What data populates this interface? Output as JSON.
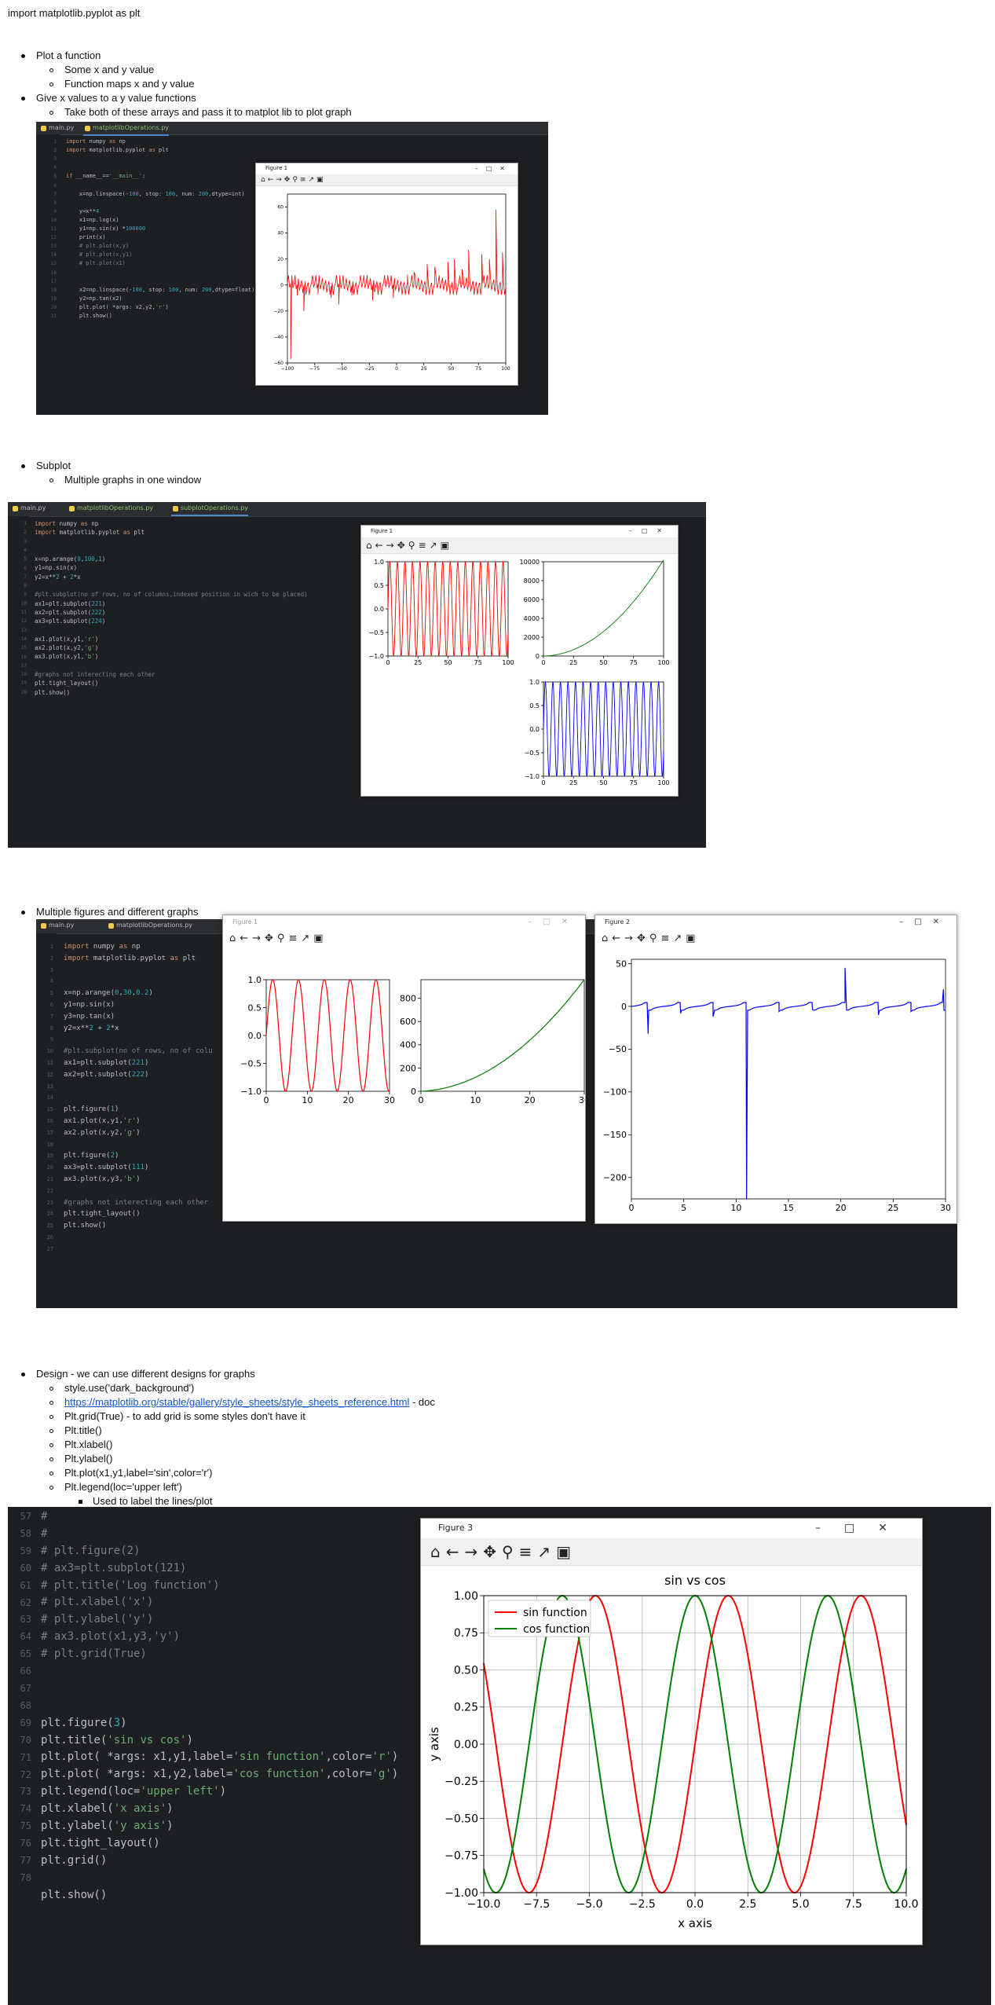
{
  "heading": "import matplotlib.pyplot as plt",
  "s1": {
    "b1": "Plot a function",
    "b1a": "Some x and y value",
    "b1b": "Function maps x and y value",
    "b2": "Give x values to a y value functions",
    "b2a": "Take both of these arrays and pass it to matplot lib to plot graph"
  },
  "ide1": {
    "tabs": [
      "main.py",
      "matplotlibOperations.py"
    ],
    "code": [
      "import numpy as np",
      "import matplotlib.pyplot as plt",
      "",
      "",
      "if __name__=='__main__':",
      "",
      "    x=np.linspace(-100, stop: 100, num: 200,dtype=int)",
      "",
      "    y=x**4",
      "    x1=np.log(x)",
      "    y1=np.sin(x) *100000",
      "    print(x)",
      "    # plt.plot(x,y)",
      "    # plt.plot(x,y1)",
      "    # plt.plot(x1)",
      "",
      "",
      "    x2=np.linspace(-100, stop: 100, num: 200,dtype=float)",
      "    y2=np.tan(x2)",
      "    plt.plot( *args: x2,y2,'r')",
      "    plt.show()"
    ],
    "fig_title": "Figure 1"
  },
  "s2": {
    "b1": "Subplot",
    "b1a": "Multiple graphs in one window"
  },
  "ide2": {
    "tabs": [
      "main.py",
      "matplotlibOperations.py",
      "subplotOperations.py"
    ],
    "code": [
      "import numpy as np",
      "import matplotlib.pyplot as plt",
      "",
      "",
      "x=np.arange(0,100,1)",
      "y1=np.sin(x)",
      "y2=x**2 + 2*x",
      "",
      "#plt.subplot(no of rows, no of columns,indexed position in wich to be placed)",
      "ax1=plt.subplot(221)",
      "ax2=plt.subplot(222)",
      "ax3=plt.subplot(224)",
      "",
      "ax1.plot(x,y1,'r')",
      "ax2.plot(x,y2,'g')",
      "ax3.plot(x,y1,'b')",
      "",
      "#graphs not interecting each other",
      "plt.tight_layout()",
      "plt.show()"
    ],
    "fig_title": "Figure 1"
  },
  "s3": {
    "b1": "Multiple figures and different graphs"
  },
  "ide3": {
    "tabs": [
      "main.py",
      "matplotlibOperations.py"
    ],
    "code": [
      "import numpy as np",
      "import matplotlib.pyplot as plt",
      "",
      "",
      "x=np.arange(0,30,0.2)",
      "y1=np.sin(x)",
      "y3=np.tan(x)",
      "y2=x**2 + 2*x",
      "",
      "#plt.subplot(no of rows, no of colu",
      "ax1=plt.subplot(221)",
      "ax2=plt.subplot(222)",
      "",
      "",
      "plt.figure(1)",
      "ax1.plot(x,y1,'r')",
      "ax2.plot(x,y2,'g')",
      "",
      "plt.figure(2)",
      "ax3=plt.subplot(111)",
      "ax3.plot(x,y3,'b')",
      "",
      "#graphs not interecting each other",
      "plt.tight_layout()",
      "plt.show()",
      "",
      ""
    ],
    "fig1_title": "Figure 1",
    "fig2_title": "Figure 2"
  },
  "s4": {
    "b1": "Design - we can use different designs for graphs",
    "b1a": "style.use('dark_background')",
    "b1b_link": "https://matplotlib.org/stable/gallery/style_sheets/style_sheets_reference.html",
    "b1b_suffix": " - doc",
    "b1c": "Plt.grid(True) - to add grid is some styles don't have it",
    "b1d": "Plt.title()",
    "b1e": "Plt.xlabel()",
    "b1f": "Plt.ylabel()",
    "b1g": "Plt.plot(x1,y1,label='sin',color='r')",
    "b1h": "Plt.legend(loc='upper left')",
    "b1h1": "Used to label the lines/plot"
  },
  "ide4": {
    "code": [
      "#",
      "#",
      "# plt.figure(2)",
      "# ax3=plt.subplot(121)",
      "# plt.title('Log function')",
      "# plt.xlabel('x')",
      "# plt.ylabel('y')",
      "# ax3.plot(x1,y3,'y')",
      "# plt.grid(True)",
      "",
      "",
      "",
      "plt.figure(3)",
      "plt.title('sin vs cos')",
      "plt.plot( *args: x1,y1,label='sin function',color='r')",
      "plt.plot( *args: x1,y2,label='cos function',color='g')",
      "plt.legend(loc='upper left')",
      "plt.xlabel('x axis')",
      "plt.ylabel('y axis')",
      "plt.tight_layout()",
      "plt.grid()",
      "",
      "plt.show()"
    ],
    "line_numbers": [
      "57",
      "58",
      "59",
      "60",
      "61",
      "62",
      "63",
      "64",
      "65",
      "66",
      "67",
      "68",
      "69",
      "70",
      "71",
      "72",
      "73",
      "74",
      "75",
      "76",
      "77",
      "78"
    ],
    "fig_title": "Figure 3"
  },
  "chart_data": [
    {
      "type": "line",
      "name": "fig1-tan",
      "x_range": [
        -100,
        100
      ],
      "ylim": [
        -60,
        70
      ],
      "xticks": [
        "−100",
        "−75",
        "−50",
        "−25",
        "0",
        "25",
        "50",
        "75",
        "100"
      ],
      "yticks": [
        "60",
        "40",
        "20",
        "0",
        "−20",
        "−40",
        "−60"
      ],
      "color": "#ff0000",
      "spikes": [
        [
          -97,
          -57
        ],
        [
          -91,
          -8
        ],
        [
          -85,
          -20
        ],
        [
          -72,
          -7
        ],
        [
          -60,
          -10
        ],
        [
          -53,
          -15
        ],
        [
          -41,
          -8
        ],
        [
          -22,
          -12
        ],
        [
          -3,
          -10
        ],
        [
          10,
          8
        ],
        [
          16,
          10
        ],
        [
          28,
          16
        ],
        [
          35,
          14
        ],
        [
          47,
          18
        ],
        [
          53,
          20
        ],
        [
          60,
          12
        ],
        [
          66,
          27
        ],
        [
          78,
          24
        ],
        [
          85,
          20
        ],
        [
          91,
          58
        ],
        [
          97,
          25
        ]
      ]
    },
    {
      "type": "line",
      "name": "subplot-221-sin",
      "x_range": [
        0,
        100
      ],
      "ylim": [
        -1,
        1
      ],
      "xticks": [
        "0",
        "25",
        "50",
        "75",
        "100"
      ],
      "yticks": [
        "1.0",
        "0.5",
        "0.0",
        "−0.5",
        "−1.0"
      ],
      "color": "#ff0000"
    },
    {
      "type": "line",
      "name": "subplot-222-quadratic",
      "x_range": [
        0,
        100
      ],
      "ylim": [
        0,
        10000
      ],
      "xticks": [
        "0",
        "25",
        "50",
        "75",
        "100"
      ],
      "yticks": [
        "10000",
        "8000",
        "6000",
        "4000",
        "2000",
        "0"
      ],
      "color": "#008000"
    },
    {
      "type": "line",
      "name": "subplot-224-sin",
      "x_range": [
        0,
        100
      ],
      "ylim": [
        -1,
        1
      ],
      "xticks": [
        "0",
        "25",
        "50",
        "75",
        "100"
      ],
      "yticks": [
        "1.0",
        "0.5",
        "0.0",
        "−0.5",
        "−1.0"
      ],
      "color": "#0000ff"
    },
    {
      "type": "line",
      "name": "figure1-sin",
      "x_range": [
        0,
        30
      ],
      "ylim": [
        -1,
        1
      ],
      "xticks": [
        "0",
        "10",
        "20",
        "30"
      ],
      "yticks": [
        "1.0",
        "0.5",
        "0.0",
        "−0.5",
        "−1.0"
      ],
      "color": "#ff0000"
    },
    {
      "type": "line",
      "name": "figure1-quadratic",
      "x_range": [
        0,
        30
      ],
      "ylim": [
        0,
        960
      ],
      "xticks": [
        "0",
        "10",
        "20",
        "30"
      ],
      "yticks": [
        "800",
        "600",
        "400",
        "200",
        "0"
      ],
      "color": "#008000"
    },
    {
      "type": "line",
      "name": "figure2-tan",
      "x_range": [
        0,
        30
      ],
      "ylim": [
        -225,
        55
      ],
      "xticks": [
        "0",
        "5",
        "10",
        "15",
        "20",
        "25",
        "30"
      ],
      "yticks": [
        "50",
        "0",
        "−50",
        "−100",
        "−150",
        "−200"
      ],
      "color": "#0000ff",
      "spikes": [
        [
          1.6,
          -32
        ],
        [
          4.7,
          -8
        ],
        [
          7.8,
          -12
        ],
        [
          11.0,
          -225
        ],
        [
          14.1,
          -6
        ],
        [
          17.3,
          -4
        ],
        [
          20.4,
          45
        ],
        [
          23.6,
          -10
        ],
        [
          26.7,
          -6
        ],
        [
          29.8,
          20
        ]
      ]
    },
    {
      "type": "line",
      "title": "sin vs cos",
      "xlabel": "x axis",
      "ylabel": "y axis",
      "x_range": [
        -10,
        10
      ],
      "ylim": [
        -1.0,
        1.0
      ],
      "xticks": [
        "−10.0",
        "−7.5",
        "−5.0",
        "−2.5",
        "0.0",
        "2.5",
        "5.0",
        "7.5",
        "10.0"
      ],
      "yticks": [
        "1.00",
        "0.75",
        "0.50",
        "0.25",
        "0.00",
        "−0.25",
        "−0.50",
        "−0.75",
        "−1.00"
      ],
      "legend": "upper left",
      "grid": true,
      "series": [
        {
          "name": "sin function",
          "color": "#ff0000"
        },
        {
          "name": "cos function",
          "color": "#008000"
        }
      ]
    }
  ]
}
